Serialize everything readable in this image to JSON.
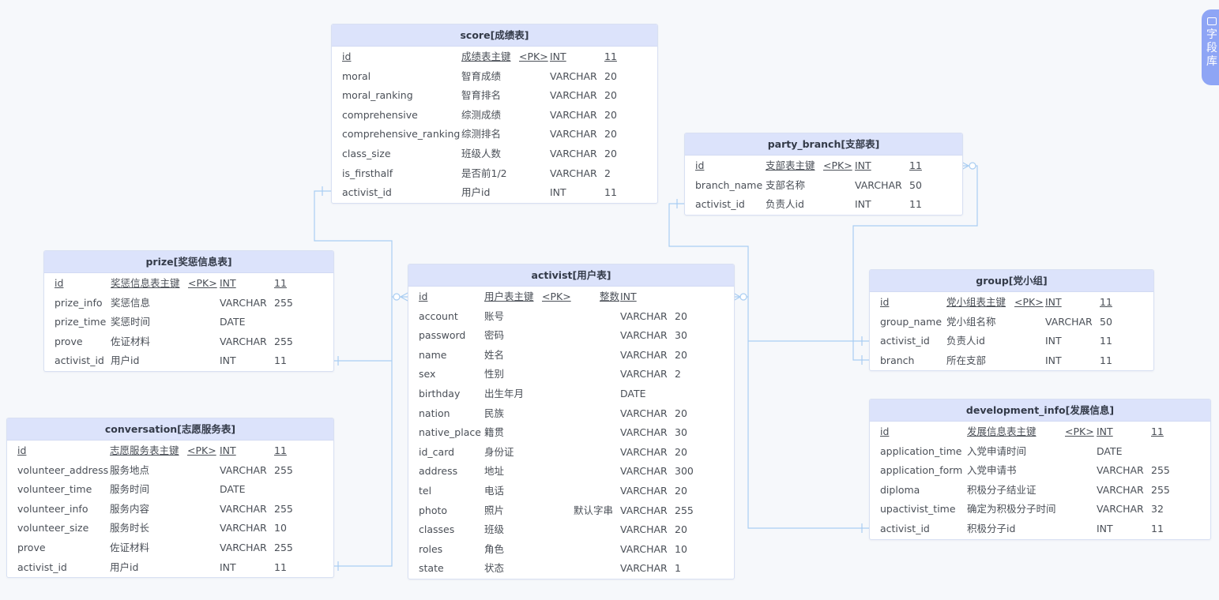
{
  "sidebar": {
    "label": "字段库",
    "icon": "package-icon"
  },
  "colors": {
    "header_bg": "#dce3fb",
    "link": "#a9cdf2",
    "border": "#d8e0f2",
    "sidebar_tab": "#8ea5f5"
  },
  "tables": [
    {
      "id": "score",
      "title": "score[成绩表]",
      "rows": [
        {
          "name": "id",
          "comment": "成绩表主键",
          "pk": "<PK>",
          "type": "INT",
          "length": "11",
          "is_pk": true
        },
        {
          "name": "moral",
          "comment": "智育成绩",
          "type": "VARCHAR",
          "length": "20"
        },
        {
          "name": "moral_ranking",
          "comment": "智育排名",
          "type": "VARCHAR",
          "length": "20"
        },
        {
          "name": "comprehensive",
          "comment": "综测成绩",
          "type": "VARCHAR",
          "length": "20"
        },
        {
          "name": "comprehensive_ranking",
          "comment": "综测排名",
          "type": "VARCHAR",
          "length": "20"
        },
        {
          "name": "class_size",
          "comment": "班级人数",
          "type": "VARCHAR",
          "length": "20"
        },
        {
          "name": "is_firsthalf",
          "comment": "是否前1/2",
          "type": "VARCHAR",
          "length": "2"
        },
        {
          "name": "activist_id",
          "comment": "用户id",
          "type": "INT",
          "length": "11"
        }
      ]
    },
    {
      "id": "party_branch",
      "title": "party_branch[支部表]",
      "rows": [
        {
          "name": "id",
          "comment": "支部表主键",
          "pk": "<PK>",
          "type": "INT",
          "length": "11",
          "is_pk": true
        },
        {
          "name": "branch_name",
          "comment": "支部名称",
          "type": "VARCHAR",
          "length": "50"
        },
        {
          "name": "activist_id",
          "comment": "负责人id",
          "type": "INT",
          "length": "11"
        }
      ]
    },
    {
      "id": "prize",
      "title": "prize[奖惩信息表]",
      "rows": [
        {
          "name": "id",
          "comment": "奖惩信息表主键",
          "pk": "<PK>",
          "type": "INT",
          "length": "11",
          "is_pk": true
        },
        {
          "name": "prize_info",
          "comment": "奖惩信息",
          "type": "VARCHAR",
          "length": "255"
        },
        {
          "name": "prize_time",
          "comment": "奖惩时间",
          "type": "DATE",
          "length": ""
        },
        {
          "name": "prove",
          "comment": "佐证材料",
          "type": "VARCHAR",
          "length": "255"
        },
        {
          "name": "activist_id",
          "comment": "用户id",
          "type": "INT",
          "length": "11"
        }
      ]
    },
    {
      "id": "activist",
      "title": "activist[用户表]",
      "rows": [
        {
          "name": "id",
          "comment": "用户表主键",
          "pk": "<PK>",
          "default": "整数",
          "type": "INT",
          "length": "",
          "is_pk": true
        },
        {
          "name": "account",
          "comment": "账号",
          "type": "VARCHAR",
          "length": "20"
        },
        {
          "name": "password",
          "comment": "密码",
          "type": "VARCHAR",
          "length": "30"
        },
        {
          "name": "name",
          "comment": "姓名",
          "type": "VARCHAR",
          "length": "20"
        },
        {
          "name": "sex",
          "comment": "性别",
          "type": "VARCHAR",
          "length": "2"
        },
        {
          "name": "birthday",
          "comment": "出生年月",
          "type": "DATE",
          "length": ""
        },
        {
          "name": "nation",
          "comment": "民族",
          "type": "VARCHAR",
          "length": "20"
        },
        {
          "name": "native_place",
          "comment": "籍贯",
          "type": "VARCHAR",
          "length": "30"
        },
        {
          "name": "id_card",
          "comment": "身份证",
          "type": "VARCHAR",
          "length": "20"
        },
        {
          "name": "address",
          "comment": "地址",
          "type": "VARCHAR",
          "length": "300"
        },
        {
          "name": "tel",
          "comment": "电话",
          "type": "VARCHAR",
          "length": "20"
        },
        {
          "name": "photo",
          "comment": "照片",
          "default": "默认字串",
          "type": "VARCHAR",
          "length": "255"
        },
        {
          "name": "classes",
          "comment": "班级",
          "type": "VARCHAR",
          "length": "20"
        },
        {
          "name": "roles",
          "comment": "角色",
          "type": "VARCHAR",
          "length": "10"
        },
        {
          "name": "state",
          "comment": "状态",
          "type": "VARCHAR",
          "length": "1"
        }
      ]
    },
    {
      "id": "group",
      "title": "group[党小组]",
      "rows": [
        {
          "name": "id",
          "comment": "党小组表主键",
          "pk": "<PK>",
          "type": "INT",
          "length": "11",
          "is_pk": true
        },
        {
          "name": "group_name",
          "comment": "党小组名称",
          "type": "VARCHAR",
          "length": "50"
        },
        {
          "name": "activist_id",
          "comment": "负责人id",
          "type": "INT",
          "length": "11"
        },
        {
          "name": "branch",
          "comment": "所在支部",
          "type": "INT",
          "length": "11"
        }
      ]
    },
    {
      "id": "conversation",
      "title": "conversation[志愿服务表]",
      "rows": [
        {
          "name": "id",
          "comment": "志愿服务表主键",
          "pk": "<PK>",
          "type": "INT",
          "length": "11",
          "is_pk": true
        },
        {
          "name": "volunteer_address",
          "comment": "服务地点",
          "type": "VARCHAR",
          "length": "255"
        },
        {
          "name": "volunteer_time",
          "comment": "服务时间",
          "type": "DATE",
          "length": ""
        },
        {
          "name": "volunteer_info",
          "comment": "服务内容",
          "type": "VARCHAR",
          "length": "255"
        },
        {
          "name": "volunteer_size",
          "comment": "服务时长",
          "type": "VARCHAR",
          "length": "10"
        },
        {
          "name": "prove",
          "comment": "佐证材料",
          "type": "VARCHAR",
          "length": "255"
        },
        {
          "name": "activist_id",
          "comment": "用户id",
          "type": "INT",
          "length": "11"
        }
      ]
    },
    {
      "id": "development_info",
      "title": "development_info[发展信息]",
      "rows": [
        {
          "name": "id",
          "comment": "发展信息表主键",
          "pk": "<PK>",
          "type": "INT",
          "length": "11",
          "is_pk": true
        },
        {
          "name": "application_time",
          "comment": "入党申请时间",
          "type": "DATE",
          "length": ""
        },
        {
          "name": "application_form",
          "comment": "入党申请书",
          "type": "VARCHAR",
          "length": "255"
        },
        {
          "name": "diploma",
          "comment": "积极分子结业证",
          "type": "VARCHAR",
          "length": "255"
        },
        {
          "name": "upactivist_time",
          "comment": "确定为积极分子时间",
          "type": "VARCHAR",
          "length": "32"
        },
        {
          "name": "activist_id",
          "comment": "积极分子id",
          "type": "INT",
          "length": "11"
        }
      ]
    }
  ]
}
